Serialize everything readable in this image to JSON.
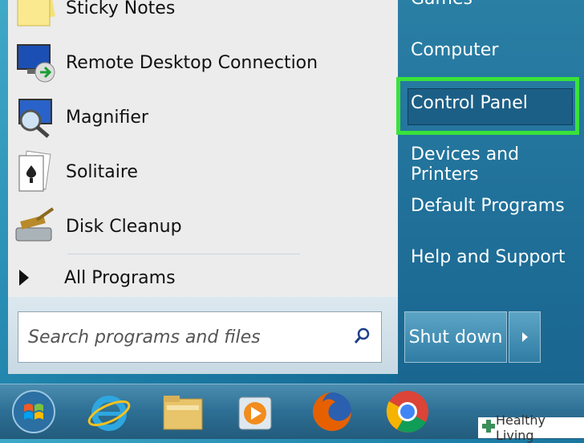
{
  "start_menu": {
    "programs": [
      {
        "label": "Sticky Notes",
        "icon": "sticky-notes-icon"
      },
      {
        "label": "Remote Desktop Connection",
        "icon": "remote-desktop-icon"
      },
      {
        "label": "Magnifier",
        "icon": "magnifier-icon"
      },
      {
        "label": "Solitaire",
        "icon": "solitaire-icon"
      },
      {
        "label": "Disk Cleanup",
        "icon": "disk-cleanup-icon"
      }
    ],
    "all_programs_label": "All Programs",
    "search": {
      "placeholder": "Search programs and files",
      "icon": "search-icon"
    },
    "right_items": [
      {
        "label": "Games"
      },
      {
        "label": "Computer"
      },
      {
        "label": "Control Panel",
        "highlighted": true
      },
      {
        "label": "Devices and Printers"
      },
      {
        "label": "Default Programs"
      },
      {
        "label": "Help and Support"
      }
    ],
    "shutdown_label": "Shut down",
    "highlight_color": "#39e23a"
  },
  "taskbar": {
    "icons": [
      "start-orb-icon",
      "internet-explorer-icon",
      "file-explorer-icon",
      "media-player-icon",
      "firefox-icon",
      "chrome-icon"
    ]
  },
  "watermark": {
    "text": "Healthy Living"
  }
}
